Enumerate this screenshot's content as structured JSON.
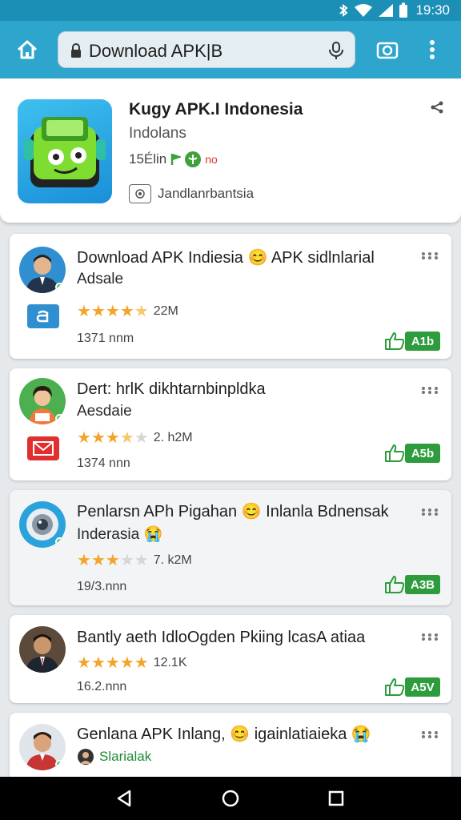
{
  "status_bar": {
    "time": "19:30",
    "icons": [
      "bluetooth-icon",
      "wifi-icon",
      "signal-icon",
      "battery-icon"
    ]
  },
  "browser": {
    "url": "Download APK|B",
    "icons": [
      "home-icon",
      "lock-icon",
      "mic-icon",
      "camera-icon",
      "menu-icon"
    ]
  },
  "app": {
    "title": "Kugy APK.I Indonesia",
    "subtitle": "Indolans",
    "stats_text": "15Élin",
    "stats_extra": "no",
    "developer": "Jandlanrbantsia"
  },
  "colors": {
    "accent": "#2da5cc",
    "status_bar": "#1c8fb6",
    "tag": "#2e9b3d",
    "star": "#f4a32b"
  },
  "list": [
    {
      "title": "Download APK Indiesia 😊 APK sidlnlarial",
      "subtitle": "Adsale",
      "rating_text": "22M",
      "rating_stars": 4.5,
      "info": "1371 nnm",
      "tag": "A1b"
    },
    {
      "title": "Dert: hrlK dikhtarnbinpldka",
      "subtitle": "Aesdaie",
      "rating_text": "2. h2M",
      "rating_stars": 3.5,
      "info": "1374 nnn",
      "tag": "A5b"
    },
    {
      "title": "Penlarsn APh Pigahan 😊 Inlanla Bdnensak",
      "subtitle": "Inderasia 😭",
      "rating_text": "7. k2M",
      "rating_stars": 3,
      "info": "19/3.nnn",
      "tag": "A3B"
    },
    {
      "title": "Bantly aeth IdloOgden Pkiing lcasA atiaa",
      "rating_text": "12.1K",
      "rating_stars": 5,
      "info": "16.2.nnn",
      "tag": "A5V"
    },
    {
      "title": "Genlana APK Inlang, 😊 igainlatiaieka 😭",
      "developer": "Slarialak"
    }
  ]
}
